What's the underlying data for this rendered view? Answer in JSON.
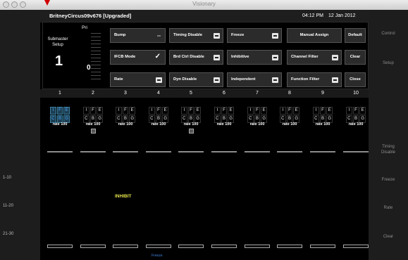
{
  "window": {
    "title": "Visionary"
  },
  "status": {
    "show_name": "BritneyCircus09v676 [Upgraded]",
    "time": "04:12 PM",
    "date": "12 Jan 2012"
  },
  "submaster": {
    "label_line1": "Submaster",
    "label_line2": "Setup",
    "value": "1"
  },
  "priority": {
    "label": "Pri",
    "value": "0"
  },
  "controls": {
    "bump": "Bump",
    "ifcb_mode": "IFCB Mode",
    "rate": "Rate",
    "timing_disable": "Timing Disable",
    "brd_ctrl_disable": "Brd Ctrl Disable",
    "dyn_disable": "Dyn Disable",
    "freeze": "Freeze",
    "inhibitive": "Inhibitive",
    "independent": "Independent",
    "manual_assign": "Manual Assign",
    "channel_filter": "Channel Filter",
    "function_filter": "Function Filter",
    "default": "Default",
    "clear": "Clear",
    "close": "Close"
  },
  "columns": [
    "1",
    "2",
    "3",
    "4",
    "5",
    "6",
    "7",
    "8",
    "9",
    "10"
  ],
  "channels": [
    {
      "row1": [
        "I",
        "F",
        "E"
      ],
      "row2": [
        "C",
        "B",
        "G"
      ],
      "rate": "rate 100",
      "selected": true,
      "icon": false
    },
    {
      "row1": [
        "I",
        "F",
        "E"
      ],
      "row2": [
        "C",
        "B",
        "G"
      ],
      "rate": "rate 100",
      "selected": false,
      "icon": true
    },
    {
      "row1": [
        "I",
        "F",
        "E"
      ],
      "row2": [
        "C",
        "B",
        "G"
      ],
      "rate": "rate 100",
      "selected": false,
      "icon": false
    },
    {
      "row1": [
        "I",
        "F",
        "E"
      ],
      "row2": [
        "C",
        "B",
        "G"
      ],
      "rate": "rate 100",
      "selected": false,
      "icon": false
    },
    {
      "row1": [
        "I",
        "F",
        "E"
      ],
      "row2": [
        "C",
        "B",
        "G"
      ],
      "rate": "rate 100",
      "selected": false,
      "icon": true
    },
    {
      "row1": [
        "I",
        "F",
        "E"
      ],
      "row2": [
        "C",
        "B",
        "G"
      ],
      "rate": "rate 100",
      "selected": false,
      "icon": false
    },
    {
      "row1": [
        "I",
        "F",
        "E"
      ],
      "row2": [
        "C",
        "B",
        "G"
      ],
      "rate": "rate 100",
      "selected": false,
      "icon": false
    },
    {
      "row1": [
        "I",
        "F",
        "E"
      ],
      "row2": [
        "C",
        "B",
        "G"
      ],
      "rate": "rate 100",
      "selected": false,
      "icon": false
    },
    {
      "row1": [
        "I",
        "F",
        "E"
      ],
      "row2": [
        "C",
        "B",
        "G"
      ],
      "rate": "rate 100",
      "selected": false,
      "icon": false
    },
    {
      "row1": [
        "I",
        "F",
        "E"
      ],
      "row2": [
        "C",
        "B",
        "G"
      ],
      "rate": "rate 100",
      "selected": false,
      "icon": false
    }
  ],
  "inhibit_label": "INHIBIT",
  "bottom_label": "Freeze",
  "left_ranges": [
    "1-10",
    "11-20",
    "21-30"
  ],
  "right_menu": {
    "control": "Control",
    "setup": "Setup",
    "timing_line1": "Timing",
    "timing_line2": "Disable",
    "freeze": "Freeze",
    "rate": "Rate",
    "clear": "Clear"
  },
  "colors": {
    "accent_blue": "#4aa9ff",
    "inhibit_yellow": "#e2e24a",
    "panel_gray": "#2b2b2b"
  }
}
